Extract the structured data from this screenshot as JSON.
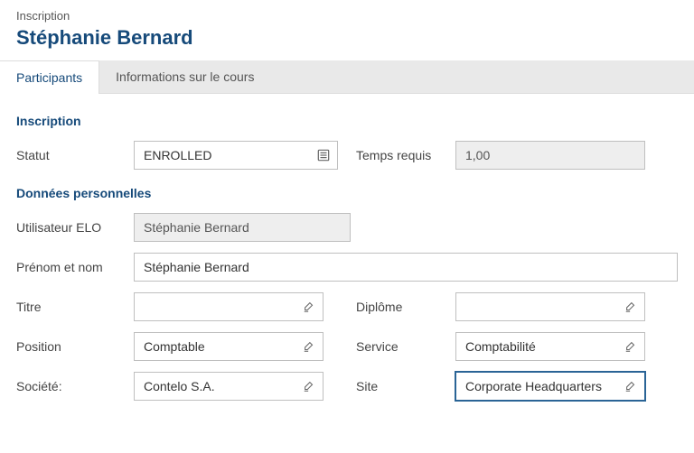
{
  "header": {
    "kicker": "Inscription",
    "title": "Stéphanie Bernard"
  },
  "tabs": {
    "participants": "Participants",
    "course_info": "Informations sur le cours"
  },
  "section": {
    "inscription": "Inscription",
    "personal": "Données personnelles"
  },
  "labels": {
    "status": "Statut",
    "time_required": "Temps requis",
    "elo_user": "Utilisateur ELO",
    "full_name": "Prénom et nom",
    "title": "Titre",
    "diploma": "Diplôme",
    "position": "Position",
    "service": "Service",
    "company": "Société:",
    "site": "Site"
  },
  "values": {
    "status": "ENROLLED",
    "time_required": "1,00",
    "elo_user": "Stéphanie Bernard",
    "full_name": "Stéphanie Bernard",
    "title": "",
    "diploma": "",
    "position": "Comptable",
    "service": "Comptabilité",
    "company": "Contelo S.A.",
    "site": "Corporate Headquarters"
  }
}
